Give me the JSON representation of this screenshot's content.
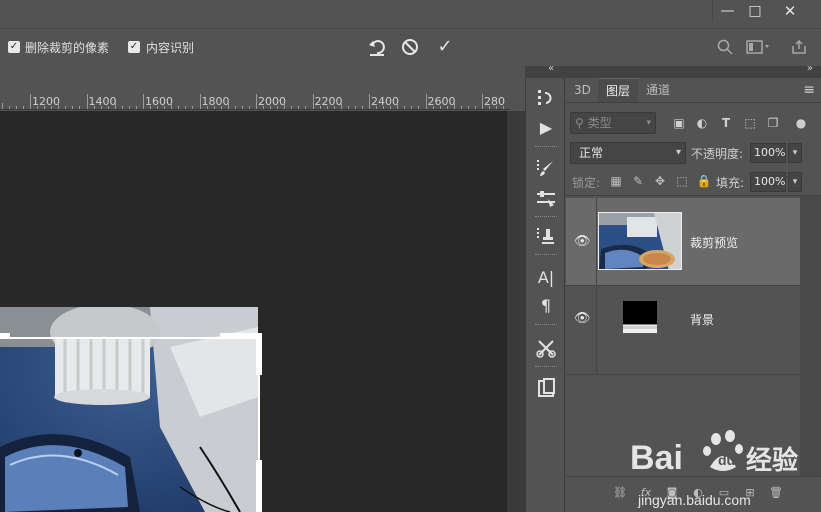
{
  "window": {
    "minimize_glyph": "—",
    "maximize_glyph": "□",
    "close_glyph": "✕"
  },
  "options_bar": {
    "delete_cropped_label": "删除裁剪的像素",
    "content_aware_label": "内容识别",
    "checkmark": "✓"
  },
  "ruler": {
    "ticks": [
      "1200",
      "1400",
      "1600",
      "1800",
      "2000",
      "2200",
      "2400",
      "2600",
      "280"
    ]
  },
  "layers_panel": {
    "tabs": [
      "3D",
      "图层",
      "通道"
    ],
    "active_tab": "图层",
    "filter_placeholder": "类型",
    "blend_mode": "正常",
    "opacity_label": "不透明度:",
    "opacity_value": "100%",
    "lock_label": "锁定:",
    "fill_label": "填充:",
    "fill_value": "100%",
    "layers": [
      {
        "name": "裁剪预览",
        "selected": true
      },
      {
        "name": "背景",
        "selected": false
      }
    ]
  },
  "watermark": {
    "logo_text": "Bai 经验",
    "url": "jingyan.baidu.com"
  },
  "icons": {
    "window": [
      "minimize-icon",
      "maximize-icon",
      "close-icon"
    ],
    "options": [
      "reset-icon",
      "cancel-icon",
      "commit-icon",
      "search-icon",
      "workspace-icon",
      "share-icon"
    ],
    "tools": [
      "history-icon",
      "play-icon",
      "brush-preset-icon",
      "adjustments-icon",
      "clone-source-icon",
      "character-icon",
      "paragraph-icon",
      "tool-presets-icon",
      "properties-icon"
    ]
  }
}
